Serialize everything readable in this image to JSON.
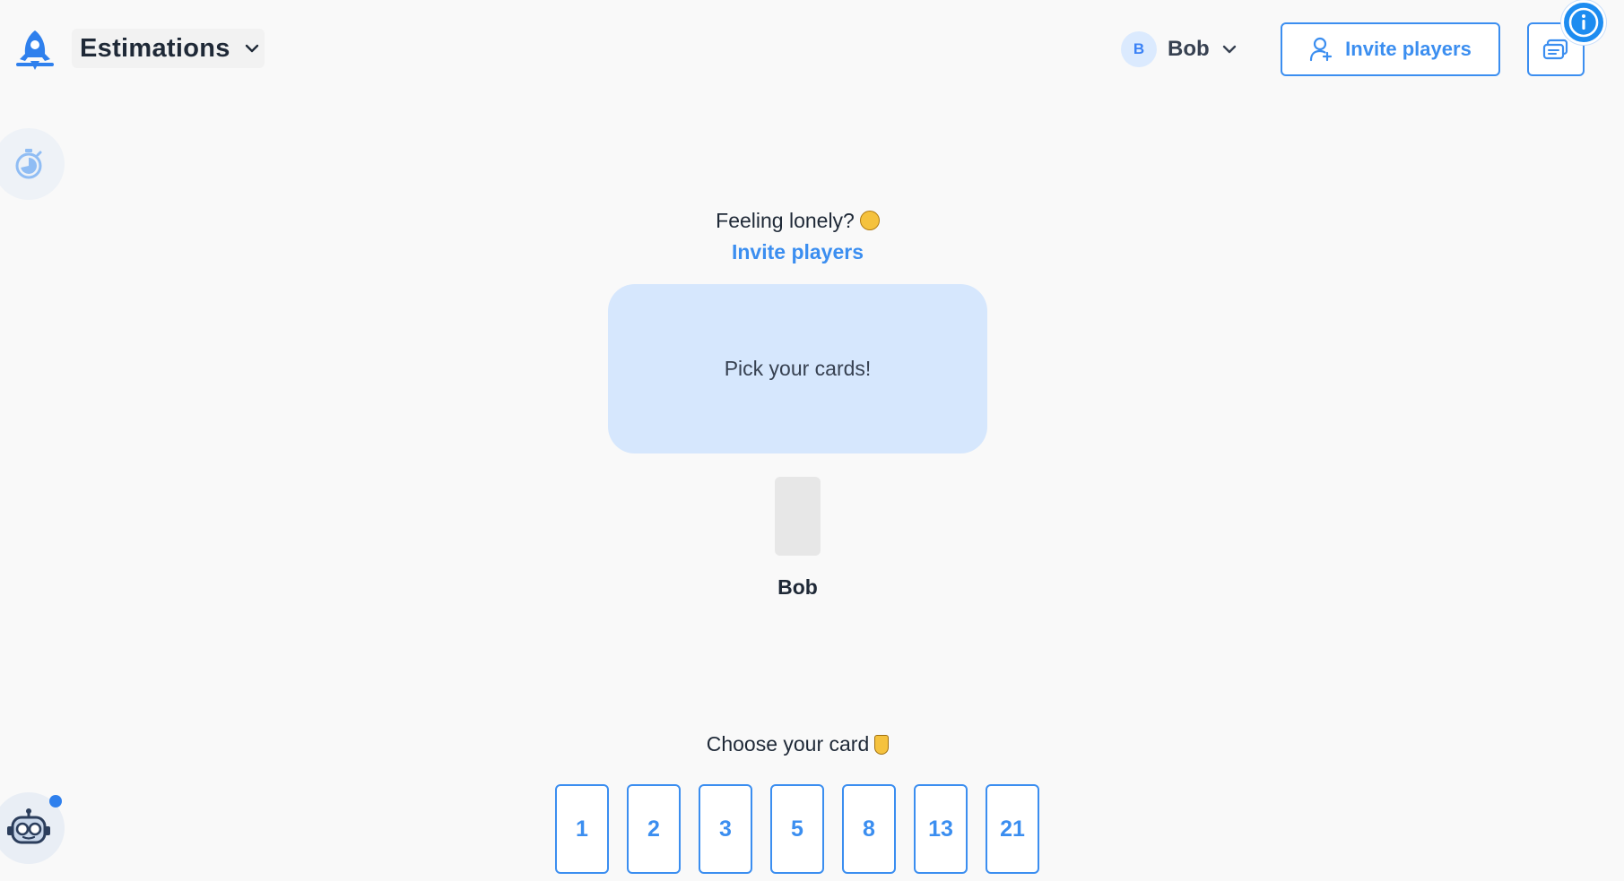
{
  "header": {
    "game_name": "Estimations",
    "user": {
      "initial": "B",
      "name": "Bob"
    },
    "invite_button_label": "Invite players"
  },
  "table": {
    "lonely_text": "Feeling lonely?",
    "invite_link_label": "Invite players",
    "prompt": "Pick your cards!"
  },
  "players": [
    {
      "name": "Bob",
      "voted": false
    }
  ],
  "deck": {
    "prompt": "Choose your card",
    "cards": [
      "1",
      "2",
      "3",
      "5",
      "8",
      "13",
      "21"
    ]
  },
  "colors": {
    "accent": "#3b8ef0",
    "table": "#d6e7fd",
    "background": "#f9f9f9"
  },
  "icons": {
    "logo": "rocket-logo-icon",
    "invite": "add-user-icon",
    "chat": "chat-icon",
    "info": "info-icon",
    "timer": "timer-icon",
    "bot": "robot-icon"
  }
}
